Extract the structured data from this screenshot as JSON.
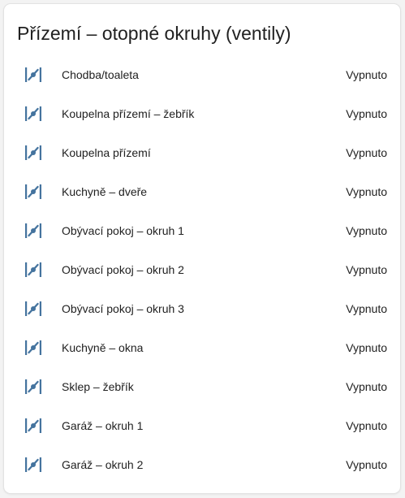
{
  "card": {
    "title": "Přízemí – otopné okruhy (ventily)"
  },
  "colors": {
    "icon": "#44739e",
    "text": "#212121",
    "card_background": "#ffffff"
  },
  "entities": [
    {
      "name": "Chodba/toaleta",
      "state": "Vypnuto",
      "icon": "valve-closed-icon"
    },
    {
      "name": "Koupelna přízemí – žebřík",
      "state": "Vypnuto",
      "icon": "valve-closed-icon"
    },
    {
      "name": "Koupelna přízemí",
      "state": "Vypnuto",
      "icon": "valve-closed-icon"
    },
    {
      "name": "Kuchyně – dveře",
      "state": "Vypnuto",
      "icon": "valve-closed-icon"
    },
    {
      "name": "Obývací pokoj – okruh 1",
      "state": "Vypnuto",
      "icon": "valve-closed-icon"
    },
    {
      "name": "Obývací pokoj – okruh 2",
      "state": "Vypnuto",
      "icon": "valve-closed-icon"
    },
    {
      "name": "Obývací pokoj – okruh 3",
      "state": "Vypnuto",
      "icon": "valve-closed-icon"
    },
    {
      "name": "Kuchyně – okna",
      "state": "Vypnuto",
      "icon": "valve-closed-icon"
    },
    {
      "name": "Sklep – žebřík",
      "state": "Vypnuto",
      "icon": "valve-closed-icon"
    },
    {
      "name": "Garáž – okruh 1",
      "state": "Vypnuto",
      "icon": "valve-closed-icon"
    },
    {
      "name": "Garáž – okruh 2",
      "state": "Vypnuto",
      "icon": "valve-closed-icon"
    }
  ]
}
